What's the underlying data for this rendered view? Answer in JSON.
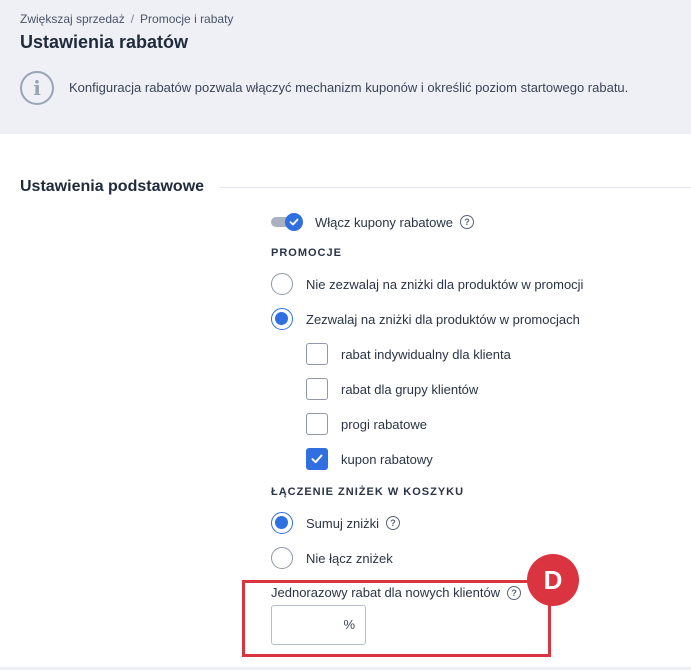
{
  "breadcrumb": {
    "items": [
      "Zwiększaj sprzedaż",
      "Promocje i rabaty"
    ],
    "separator": "/"
  },
  "page": {
    "title": "Ustawienia rabatów",
    "info_icon": "info-icon",
    "info_text": "Konfiguracja rabatów pozwala włączyć mechanizm kuponów i określić poziom startowego rabatu."
  },
  "section": {
    "title": "Ustawienia podstawowe"
  },
  "coupons_toggle": {
    "label": "Włącz kupony rabatowe",
    "enabled": true,
    "help": "?"
  },
  "promotions": {
    "label": "PROMOCJE",
    "options": [
      {
        "label": "Nie zezwalaj na zniżki dla produktów w promocji",
        "selected": false
      },
      {
        "label": "Zezwalaj na zniżki dla produktów w promocjach",
        "selected": true
      }
    ],
    "checkboxes": [
      {
        "label": "rabat indywidualny dla klienta",
        "checked": false
      },
      {
        "label": "rabat dla grupy klientów",
        "checked": false
      },
      {
        "label": "progi rabatowe",
        "checked": false
      },
      {
        "label": "kupon rabatowy",
        "checked": true
      }
    ]
  },
  "combine": {
    "label": "ŁĄCZENIE ZNIŻEK W KOSZYKU",
    "options": [
      {
        "label": "Sumuj zniżki",
        "selected": true,
        "help": "?"
      },
      {
        "label": "Nie łącz zniżek",
        "selected": false
      }
    ]
  },
  "new_client_discount": {
    "label": "Jednorazowy rabat dla nowych klientów",
    "help": "?",
    "value": "",
    "unit": "%"
  },
  "annotation": {
    "badge": "D",
    "color": "#d9343f"
  },
  "colors": {
    "accent": "#2f6fe0",
    "header_bg": "#eef0f5"
  }
}
